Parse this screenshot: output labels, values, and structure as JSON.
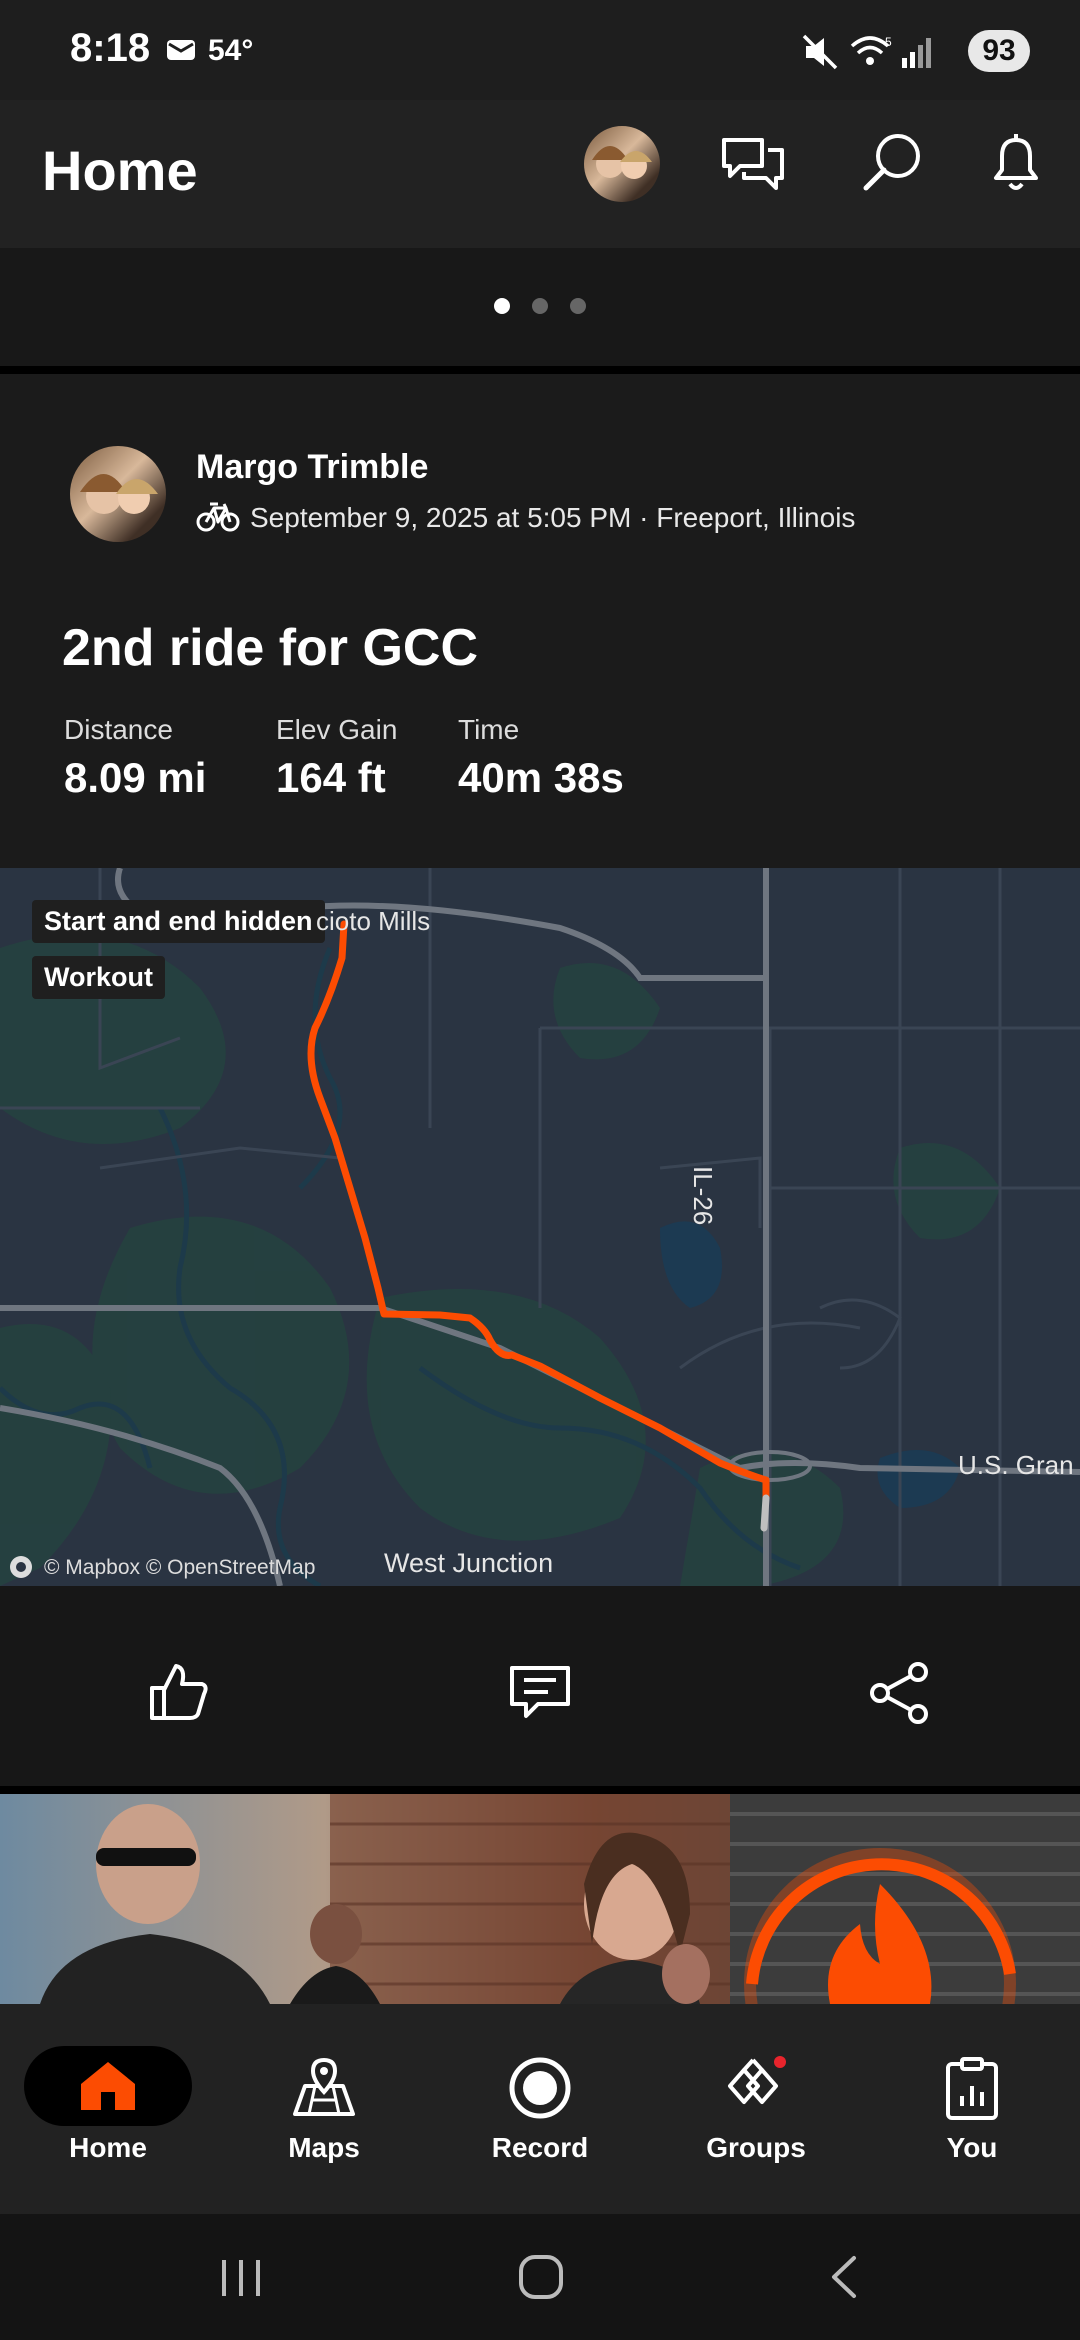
{
  "status_bar": {
    "time": "8:18",
    "temperature": "54°",
    "battery": "93"
  },
  "header": {
    "title": "Home"
  },
  "activity": {
    "athlete_name": "Margo Trimble",
    "meta": "September 9, 2025 at 5:05 PM · Freeport, Illinois",
    "title": "2nd ride for GCC",
    "stats": [
      {
        "label": "Distance",
        "value": "8.09 mi"
      },
      {
        "label": "Elev Gain",
        "value": "164 ft"
      },
      {
        "label": "Time",
        "value": "40m 38s"
      }
    ],
    "map": {
      "badge_privacy": "Start and end hidden",
      "badge_type": "Workout",
      "place_mills": "cioto Mills",
      "road_il26": "IL-26",
      "road_us": "U.S. Gran",
      "place_junction": "West Junction",
      "attribution": "© Mapbox © OpenStreetMap"
    }
  },
  "nav": {
    "items": [
      {
        "label": "Home"
      },
      {
        "label": "Maps"
      },
      {
        "label": "Record"
      },
      {
        "label": "Groups"
      },
      {
        "label": "You"
      }
    ]
  },
  "colors": {
    "accent": "#fc4c02",
    "background": "#1a1a1a",
    "map_bg": "#2a3442"
  }
}
